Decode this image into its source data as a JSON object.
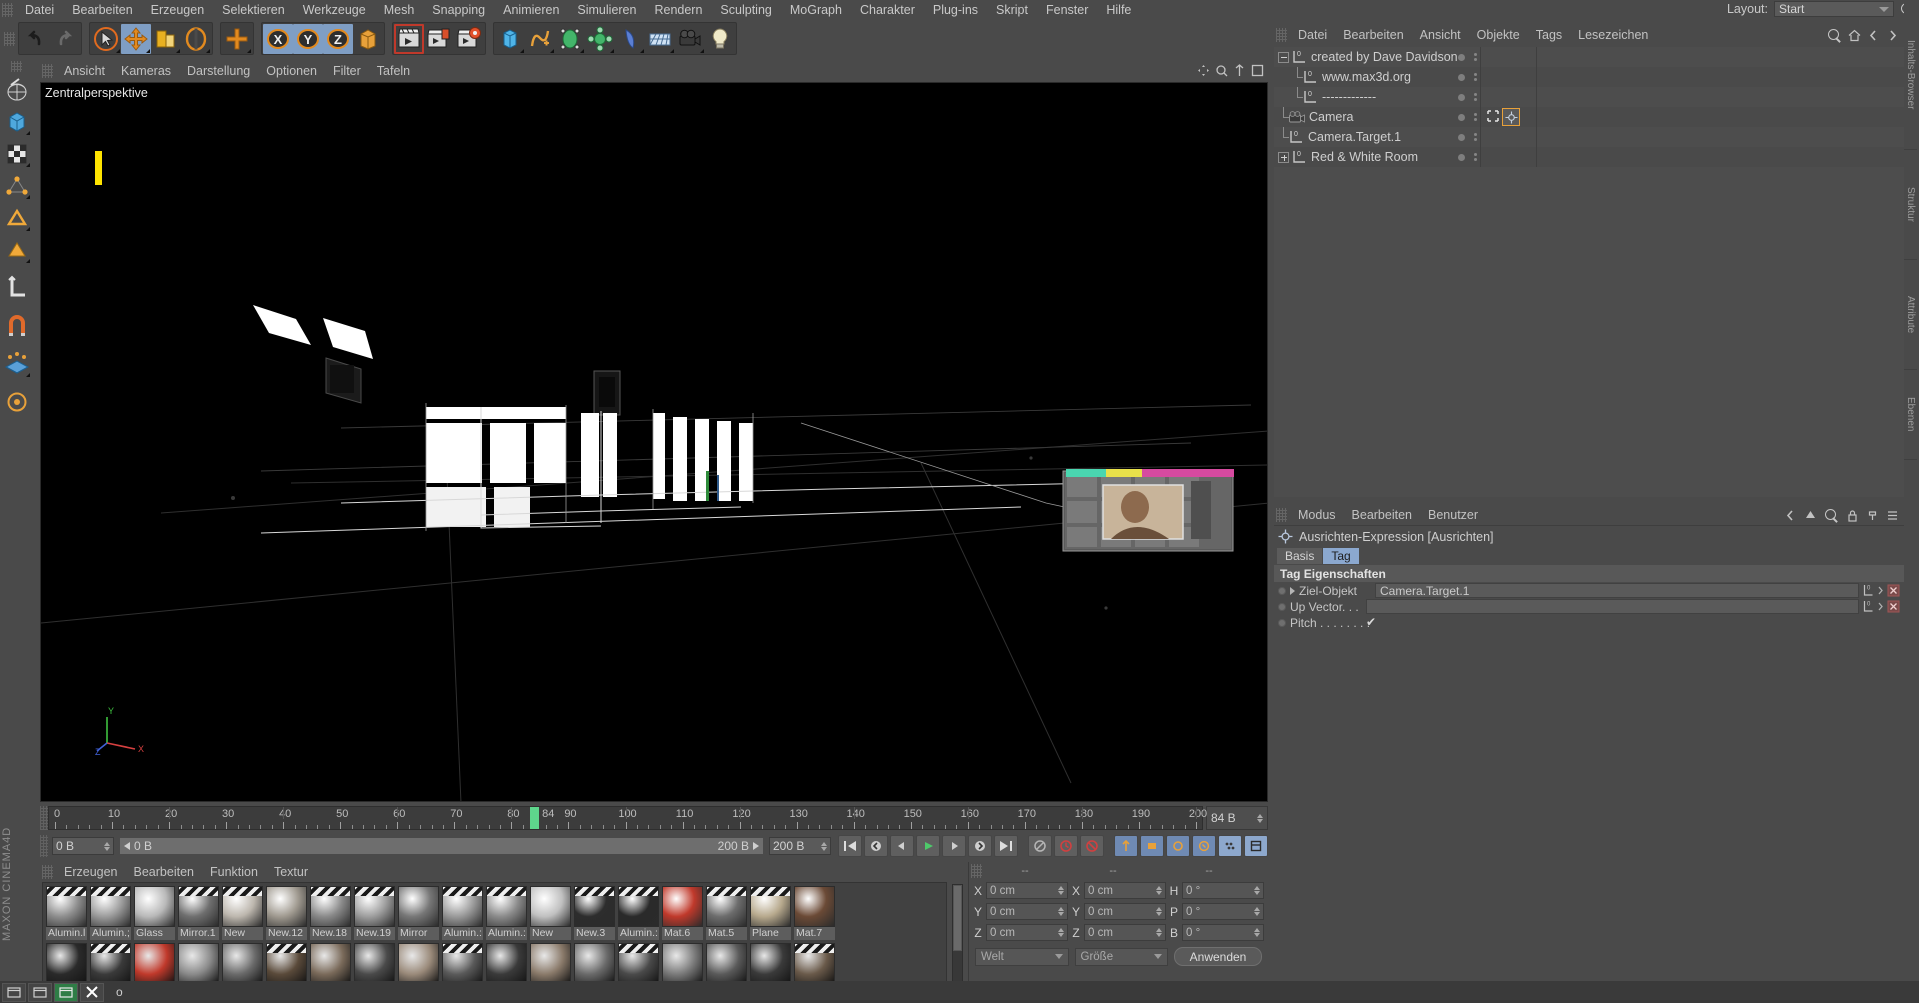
{
  "app": {
    "title": "CINEMA 4D",
    "brand_label": "MAXON CINEMA4D"
  },
  "main_menu": {
    "items": [
      "Datei",
      "Bearbeiten",
      "Erzeugen",
      "Selektieren",
      "Werkzeuge",
      "Mesh",
      "Snapping",
      "Animieren",
      "Simulieren",
      "Rendern",
      "Sculpting",
      "MoGraph",
      "Charakter",
      "Plug-ins",
      "Skript",
      "Fenster",
      "Hilfe"
    ],
    "layout_label": "Layout:",
    "layout_value": "Start",
    "search_icon": "magnifier-icon"
  },
  "toolbar": {
    "groups": [
      {
        "name": "undo-redo",
        "buttons": [
          {
            "name": "undo-button",
            "icon": "undo-arrow-icon",
            "active": false
          },
          {
            "name": "redo-button",
            "icon": "redo-arrow-icon",
            "active": false
          }
        ]
      },
      {
        "name": "transform-tools",
        "buttons": [
          {
            "name": "select-tool",
            "icon": "cursor-in-circle-icon",
            "active": false
          },
          {
            "name": "move-tool",
            "icon": "move-cross-icon",
            "active": true
          },
          {
            "name": "scale-tool",
            "icon": "scale-box-icon",
            "active": false
          },
          {
            "name": "rotate-tool",
            "icon": "rotate-circle-icon",
            "active": false
          }
        ]
      },
      {
        "name": "world-axis",
        "buttons": [
          {
            "name": "axis-lock-tool",
            "icon": "plus-cross-icon",
            "active": false
          }
        ]
      },
      {
        "name": "axis-locks",
        "buttons": [
          {
            "name": "lock-x-axis",
            "icon": "x-axis-icon",
            "active": true
          },
          {
            "name": "lock-y-axis",
            "icon": "y-axis-icon",
            "active": true
          },
          {
            "name": "lock-z-axis",
            "icon": "z-axis-icon",
            "active": true
          },
          {
            "name": "world-object-coords",
            "icon": "world-coords-icon",
            "active": false
          }
        ]
      },
      {
        "name": "render-group",
        "buttons": [
          {
            "name": "render-view-button",
            "icon": "clapboard-render-icon",
            "active": false
          },
          {
            "name": "render-to-picture-viewer-button",
            "icon": "clapboard-picture-icon",
            "active": false
          },
          {
            "name": "render-settings-button",
            "icon": "clapboard-gear-icon",
            "active": false
          }
        ]
      },
      {
        "name": "create-group",
        "buttons": [
          {
            "name": "add-cube-button",
            "icon": "cube-icon",
            "active": false
          },
          {
            "name": "add-spline-button",
            "icon": "spline-pen-icon",
            "active": false
          },
          {
            "name": "add-generator-button",
            "icon": "nurbs-green-icon",
            "active": false
          },
          {
            "name": "add-deformer-button",
            "icon": "deformer-icon",
            "active": false
          },
          {
            "name": "add-environment-button",
            "icon": "sky-icon",
            "active": false
          },
          {
            "name": "add-scene-button",
            "icon": "floor-grid-icon",
            "active": false
          },
          {
            "name": "add-camera-button",
            "icon": "camera-icon",
            "active": false
          },
          {
            "name": "add-light-button",
            "icon": "light-bulb-icon",
            "active": false
          }
        ]
      }
    ]
  },
  "left_toolbar": {
    "buttons": [
      {
        "name": "make-editable-tool",
        "icon": "editable-mesh-icon"
      },
      {
        "name": "model-mode-tool",
        "icon": "model-cube-icon"
      },
      {
        "name": "texture-mode-tool",
        "icon": "texture-checker-icon"
      },
      {
        "name": "points-mode-tool",
        "icon": "points-icon"
      },
      {
        "name": "edges-mode-tool",
        "icon": "edges-icon"
      },
      {
        "name": "polygons-mode-tool",
        "icon": "polygons-icon"
      },
      {
        "name": "axis-mode-tool",
        "icon": "axis-l-icon"
      },
      {
        "name": "enable-snap-tool",
        "icon": "magnet-icon"
      },
      {
        "name": "workplane-tool",
        "icon": "workplane-icon"
      },
      {
        "name": "viewport-solo-tool",
        "icon": "solo-icon"
      }
    ]
  },
  "viewport": {
    "menu": [
      "Ansicht",
      "Kameras",
      "Darstellung",
      "Optionen",
      "Filter",
      "Tafeln"
    ],
    "label": "Zentralperspektive",
    "panel_icons": [
      "pan-icon",
      "zoom-icon",
      "dolly-icon",
      "maximize-icon"
    ],
    "axis_gizmo": {
      "x": "X",
      "y": "Y",
      "z": "Z"
    }
  },
  "timeline": {
    "ticks": [
      0,
      10,
      20,
      30,
      40,
      50,
      60,
      70,
      80,
      90,
      100,
      110,
      120,
      130,
      140,
      150,
      160,
      170,
      180,
      190,
      200
    ],
    "playhead_frame": 84,
    "playhead_label": "84",
    "current_frame_field": "84 B",
    "start_field": "0 B",
    "range_start": "0 B",
    "range_end": "200 B",
    "end_field": "200 B"
  },
  "transport": {
    "buttons": [
      {
        "name": "go-to-start-button",
        "icon": "skip-start-icon"
      },
      {
        "name": "previous-keyframe-button",
        "icon": "prev-key-icon"
      },
      {
        "name": "step-back-button",
        "icon": "step-back-icon"
      },
      {
        "name": "play-button",
        "icon": "play-icon"
      },
      {
        "name": "step-forward-button",
        "icon": "step-forward-icon"
      },
      {
        "name": "next-keyframe-button",
        "icon": "next-key-icon"
      },
      {
        "name": "go-to-end-button",
        "icon": "skip-end-icon"
      },
      {
        "name": "loop-button",
        "icon": "loop-icon"
      },
      {
        "name": "record-active-objects-button",
        "icon": "record-icon"
      },
      {
        "name": "autokeying-button",
        "icon": "autokey-icon"
      },
      {
        "name": "record-position-button",
        "icon": "key-position-icon"
      },
      {
        "name": "record-scale-button",
        "icon": "key-scale-icon"
      },
      {
        "name": "record-rotation-button",
        "icon": "key-rotation-icon"
      },
      {
        "name": "record-parameter-button",
        "icon": "key-param-icon"
      },
      {
        "name": "record-pla-button",
        "icon": "key-pla-icon"
      },
      {
        "name": "animation-layout-button",
        "icon": "anim-layout-icon"
      }
    ]
  },
  "material_manager": {
    "menu": [
      "Erzeugen",
      "Bearbeiten",
      "Funktion",
      "Textur"
    ],
    "materials_row1": [
      "Alumin.l",
      "Alumin.;",
      "Glass",
      "Mirror.1",
      "New",
      "New.12",
      "New.18",
      "New.19",
      "Mirror",
      "Alumin.:",
      "Alumin.:",
      "New",
      "New.3",
      "Alumin.:",
      "Mat.6",
      "Mat.5",
      "Plane",
      "Mat.7"
    ],
    "materials_row2_count": 18
  },
  "coordinate_manager": {
    "col_headers": [
      "--",
      "--",
      "--"
    ],
    "rows": [
      {
        "pos_label": "X",
        "pos_value": "0 cm",
        "size_label": "X",
        "size_value": "0 cm",
        "rot_label": "H",
        "rot_value": "0 °"
      },
      {
        "pos_label": "Y",
        "pos_value": "0 cm",
        "size_label": "Y",
        "size_value": "0 cm",
        "rot_label": "P",
        "rot_value": "0 °"
      },
      {
        "pos_label": "Z",
        "pos_value": "0 cm",
        "size_label": "Z",
        "size_value": "0 cm",
        "rot_label": "B",
        "rot_value": "0 °"
      }
    ],
    "system_dropdown": "Welt",
    "mode_dropdown": "Größe",
    "apply_button": "Anwenden"
  },
  "object_manager": {
    "menu": [
      "Datei",
      "Bearbeiten",
      "Ansicht",
      "Objekte",
      "Tags",
      "Lesezeichen"
    ],
    "header_icons": [
      "magnifier-icon",
      "home-icon",
      "back-icon",
      "forward-icon"
    ],
    "rows": [
      {
        "label": "created by Dave Davidson",
        "depth": 0,
        "icon": "null-object-icon",
        "expander": "minus",
        "tags": []
      },
      {
        "label": "www.max3d.org",
        "depth": 1,
        "icon": "null-object-icon",
        "expander": "none",
        "tags": []
      },
      {
        "label": "-------------",
        "depth": 1,
        "icon": "null-object-icon",
        "expander": "none",
        "tags": []
      },
      {
        "label": "Camera",
        "depth": 0,
        "icon": "camera-object-icon",
        "expander": "none",
        "tags": [
          "protection-tag",
          "align-to-target-tag"
        ]
      },
      {
        "label": "Camera.Target.1",
        "depth": 0,
        "icon": "null-object-icon",
        "expander": "none",
        "tags": []
      },
      {
        "label": "Red & White Room",
        "depth": 0,
        "icon": "null-object-icon",
        "expander": "plus",
        "tags": []
      }
    ]
  },
  "attribute_manager": {
    "menu": [
      "Modus",
      "Bearbeiten",
      "Benutzer"
    ],
    "header_icons": [
      "prev-icon",
      "up-icon",
      "magnifier-icon",
      "lock-icon",
      "pin-icon",
      "list-icon"
    ],
    "title": "Ausrichten-Expression [Ausrichten]",
    "title_icon": "align-target-icon",
    "tabs": [
      {
        "label": "Basis",
        "selected": false
      },
      {
        "label": "Tag",
        "selected": true
      }
    ],
    "section_header": "Tag Eigenschaften",
    "fields": [
      {
        "name": "target-object-field",
        "label": "Ziel-Objekt",
        "value": "Camera.Target.1",
        "type": "link",
        "has_arrow": true
      },
      {
        "name": "up-vector-field",
        "label": "Up Vector. . .",
        "value": "",
        "type": "link",
        "has_arrow": false
      },
      {
        "name": "pitch-checkbox",
        "label": "Pitch . . . . . . . .",
        "value": "✔",
        "type": "checkbox",
        "has_arrow": false
      }
    ]
  },
  "right_tabs": [
    "Inhalts-Browser",
    "Struktur",
    "Attribute",
    "Ebenen"
  ],
  "taskbar": {
    "status": "o",
    "buttons": [
      "window-icon",
      "window-icon",
      "window-icon",
      "close-icon"
    ]
  }
}
